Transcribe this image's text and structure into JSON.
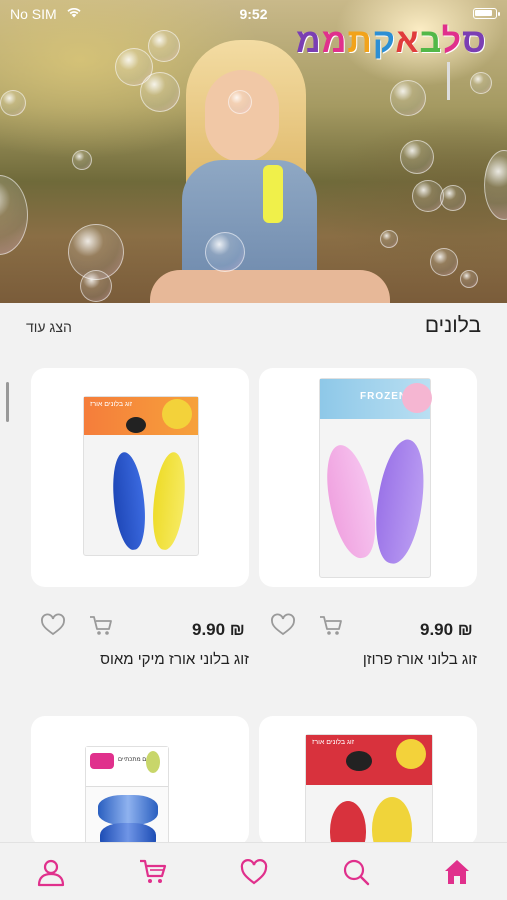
{
  "status_bar": {
    "carrier": "No SIM",
    "time": "9:52",
    "battery_level": 0.9
  },
  "brand": {
    "logo_text": "ממתקאבלס",
    "logo_letters": [
      {
        "ch": "מ",
        "color": "#7b3fb3"
      },
      {
        "ch": "מ",
        "color": "#e0308c"
      },
      {
        "ch": "ת",
        "color": "#f2a31b"
      },
      {
        "ch": "ק",
        "color": "#2b8fd4"
      },
      {
        "ch": "א",
        "color": "#e03c3c"
      },
      {
        "ch": "ב",
        "color": "#53b848"
      },
      {
        "ch": "ל",
        "color": "#e0308c"
      },
      {
        "ch": "ס",
        "color": "#7b3fb3"
      }
    ]
  },
  "section": {
    "title": "בלונים",
    "show_more": "הצג עוד"
  },
  "products": [
    {
      "name": "זוג בלוני אורז פרוזן",
      "price": "9.90 ₪",
      "package_brand": "FROZEN"
    },
    {
      "name": "זוג בלוני אורז מיקי מאוס",
      "price": "9.90 ₪",
      "package_brand": "MICKEY MOUSE"
    },
    {
      "name": "",
      "price": "",
      "package_brand": "MINNIE"
    },
    {
      "name": "",
      "price": "",
      "package_brand": ""
    }
  ],
  "package_labels": {
    "frozen": "FROZEN",
    "mickey_caption": "זוג בלונים אורז",
    "minnie_caption": "זוג בלונים אורז",
    "fourth_caption": "בלונים מתכתיים"
  },
  "nav": {
    "items": [
      "home-icon",
      "search-icon",
      "heart-icon",
      "cart-icon",
      "user-icon"
    ]
  },
  "colors": {
    "accent": "#e0308c",
    "icon_gray": "#9a9a9a",
    "background": "#f2f2f2"
  }
}
